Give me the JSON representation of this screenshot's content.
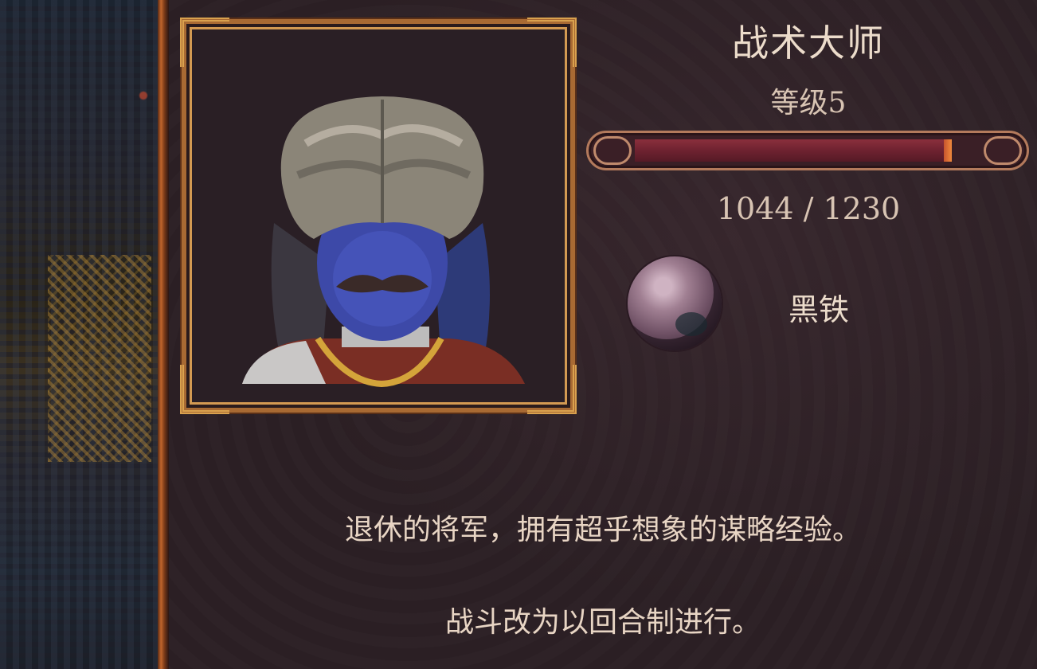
{
  "character": {
    "title": "战术大师",
    "level_label": "等级5"
  },
  "experience": {
    "current": 1044,
    "max": 1230,
    "text": "1044 / 1230",
    "fill_fraction": 0.849
  },
  "material": {
    "name": "黑铁",
    "icon": "metal-orb-icon"
  },
  "description": {
    "line1": "退休的将军，拥有超乎想象的谋略经验。",
    "line2": "战斗改为以回合制进行。"
  },
  "colors": {
    "frame_gold": "#d9a14e",
    "bar_fill": "#6e2230",
    "bar_tip": "#f08a3c",
    "text": "#ecdccb"
  }
}
